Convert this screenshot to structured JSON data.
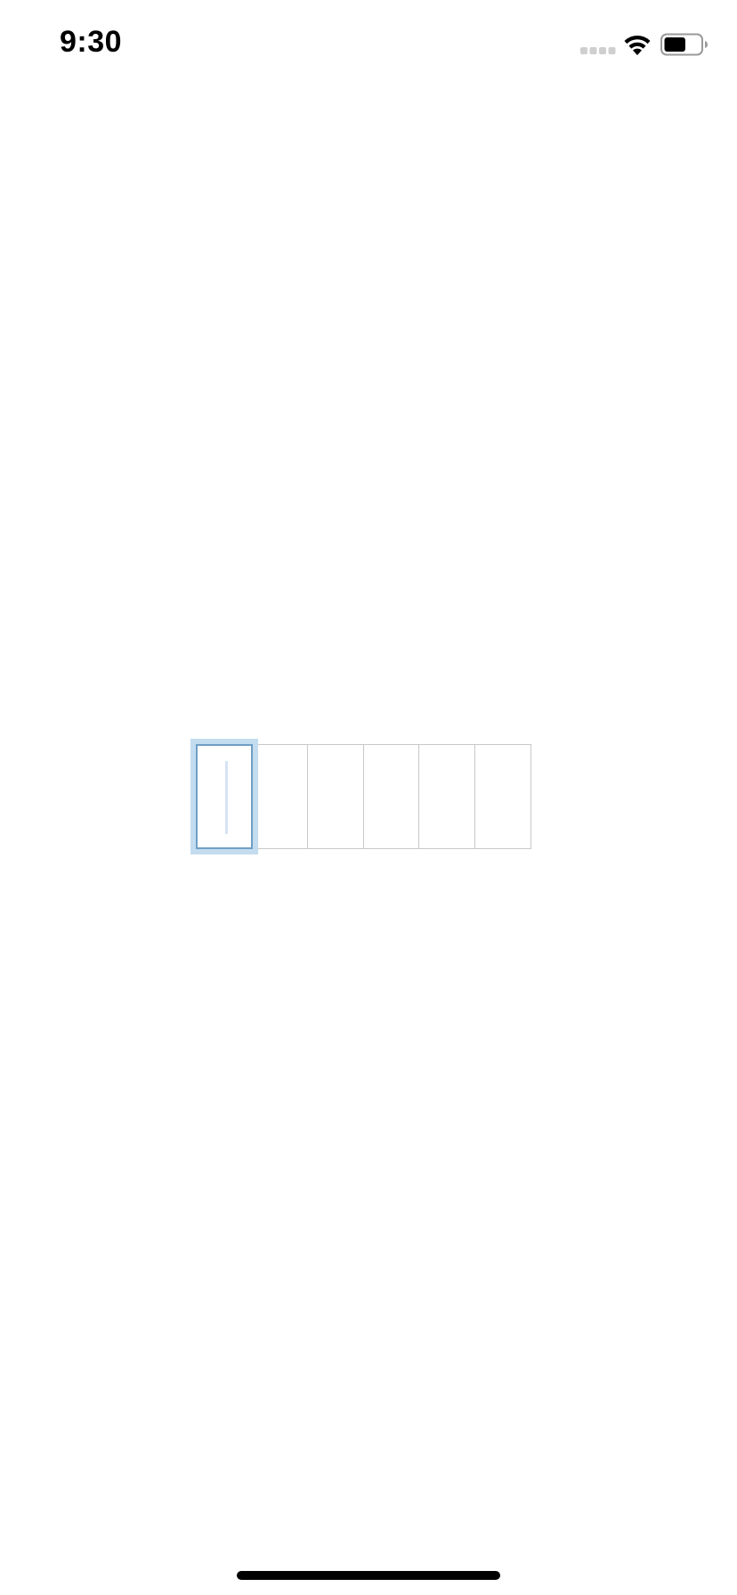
{
  "status_bar": {
    "time": "9:30",
    "signal_icon": "cellular-signal-icon",
    "wifi_icon": "wifi-icon",
    "battery_icon": "battery-icon",
    "battery_level": 0.6
  },
  "code_input": {
    "length": 6,
    "active_index": 0,
    "cells": [
      "",
      "",
      "",
      "",
      "",
      ""
    ],
    "colors": {
      "border": "#c8c8c8",
      "active_border": "#6f9fc7",
      "active_glow": "#c3dcef",
      "caret": "#d6e2f5"
    }
  },
  "home_indicator": {
    "color": "#000000"
  }
}
